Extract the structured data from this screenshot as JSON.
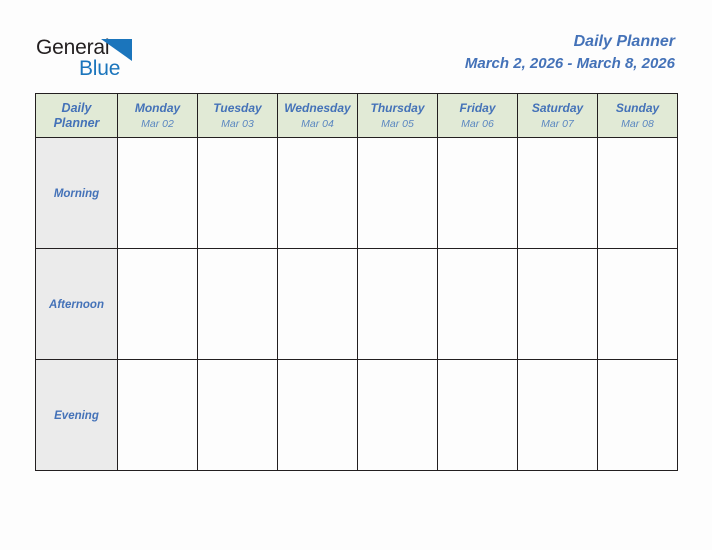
{
  "brand": {
    "name_part1": "General",
    "name_part2": "Blue",
    "mark_icon": "triangle-mark-icon",
    "colors": {
      "part1": "#231f20",
      "part2": "#1b75bc"
    }
  },
  "header": {
    "title": "Daily Planner",
    "date_range": "March 2, 2026 - March 8, 2026"
  },
  "theme": {
    "accent_blue": "#4472b8",
    "header_green": "#e1ead6",
    "row_label_gray": "#ebebeb",
    "grid_line": "#231f20",
    "page_background": "#fdfdfd"
  },
  "planner": {
    "corner_label_line1": "Daily",
    "corner_label_line2": "Planner",
    "columns": [
      {
        "day": "Monday",
        "date": "Mar 02"
      },
      {
        "day": "Tuesday",
        "date": "Mar 03"
      },
      {
        "day": "Wednesday",
        "date": "Mar 04"
      },
      {
        "day": "Thursday",
        "date": "Mar 05"
      },
      {
        "day": "Friday",
        "date": "Mar 06"
      },
      {
        "day": "Saturday",
        "date": "Mar 07"
      },
      {
        "day": "Sunday",
        "date": "Mar 08"
      }
    ],
    "rows": [
      {
        "label": "Morning",
        "entries": [
          "",
          "",
          "",
          "",
          "",
          "",
          ""
        ]
      },
      {
        "label": "Afternoon",
        "entries": [
          "",
          "",
          "",
          "",
          "",
          "",
          ""
        ]
      },
      {
        "label": "Evening",
        "entries": [
          "",
          "",
          "",
          "",
          "",
          "",
          ""
        ]
      }
    ]
  }
}
